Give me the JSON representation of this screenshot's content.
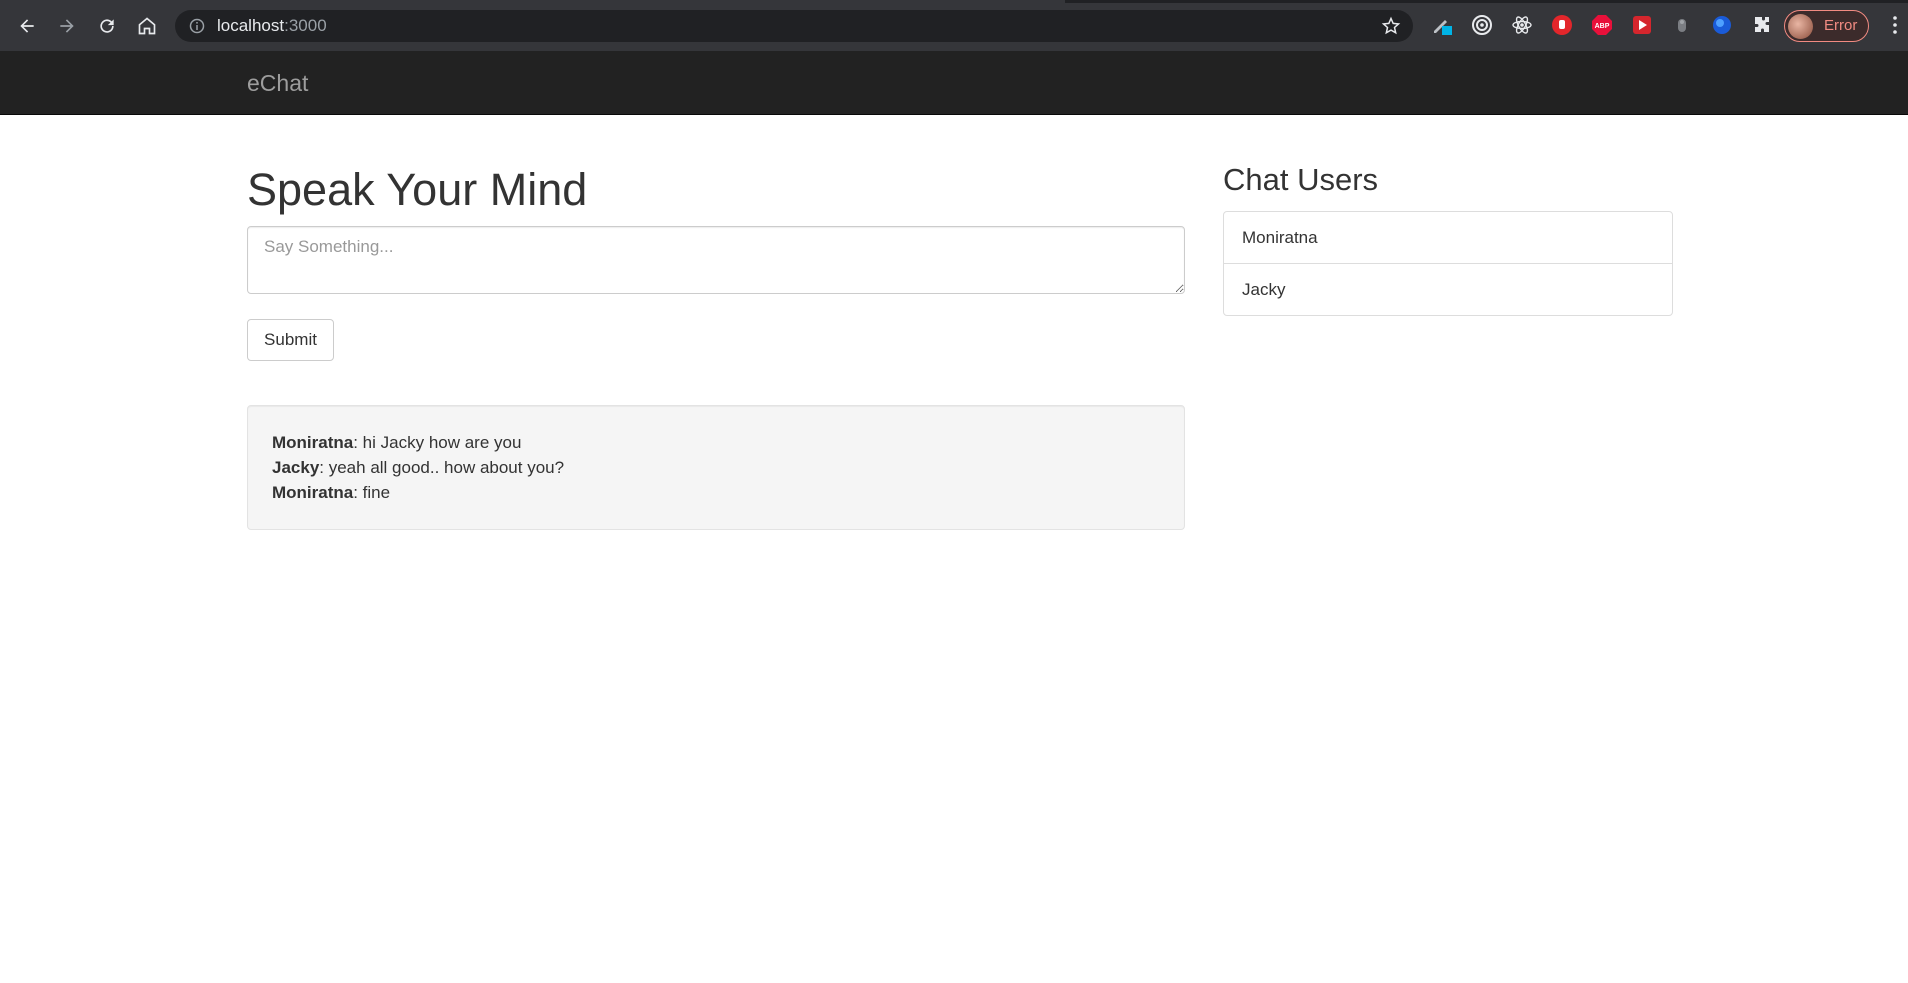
{
  "browser": {
    "url_host": "localhost",
    "url_port": ":3000",
    "profile_label": "Error",
    "icons": [
      "back-icon",
      "forward-icon",
      "reload-icon",
      "home-icon",
      "info-icon",
      "star-icon",
      "pen-extension-icon",
      "target-extension-icon",
      "react-devtools-icon",
      "red-hand-extension-icon",
      "adblock-plus-icon",
      "red-play-extension-icon",
      "gray-extension-icon",
      "blue-circle-extension-icon",
      "puzzle-icon",
      "menu-dots-icon"
    ]
  },
  "navbar": {
    "brand": "eChat"
  },
  "main": {
    "title": "Speak Your Mind",
    "input_placeholder": "Say Something...",
    "input_value": "",
    "submit_label": "Submit",
    "messages": [
      {
        "user": "Moniratna",
        "text": ": hi Jacky how are you"
      },
      {
        "user": "Jacky",
        "text": ": yeah all good.. how about you?"
      },
      {
        "user": "Moniratna",
        "text": ": fine"
      }
    ]
  },
  "sidebar": {
    "title": "Chat Users",
    "users": [
      "Moniratna",
      "Jacky"
    ]
  },
  "colors": {
    "navbar_bg": "#222222",
    "brand_text": "#9d9d9d",
    "chrome_bg": "#35363a",
    "well_bg": "#f5f5f5"
  }
}
